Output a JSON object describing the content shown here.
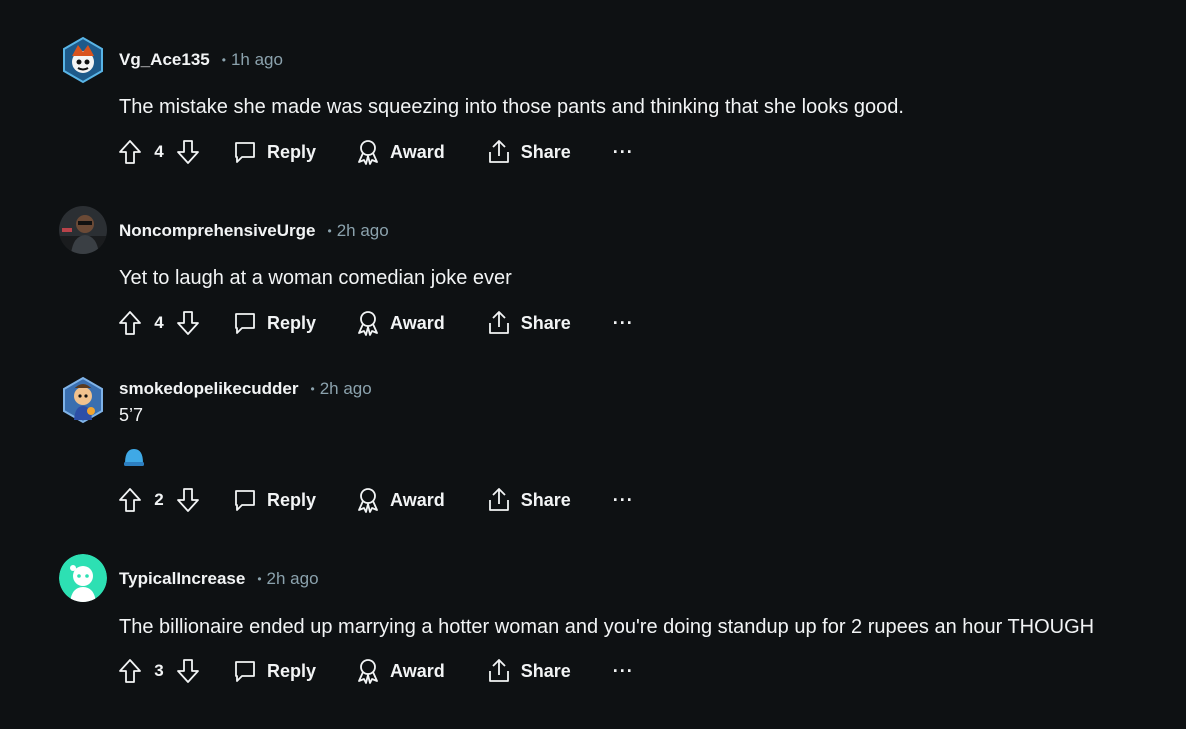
{
  "comments": [
    {
      "username": "Vg_Ace135",
      "time": "1h ago",
      "text": "The mistake she made was squeezing into those pants and thinking that she looks good.",
      "score": "4"
    },
    {
      "username": "NoncomprehensiveUrge",
      "time": "2h ago",
      "text": "Yet to laugh at a woman comedian joke ever",
      "score": "4"
    },
    {
      "username": "smokedopelikecudder",
      "time": "2h ago",
      "text": "5’7",
      "score": "2"
    },
    {
      "username": "TypicalIncrease",
      "time": "2h ago",
      "text": "The billionaire ended up marrying a hotter woman and you're doing standup up for 2 rupees an hour THOUGH",
      "score": "3"
    }
  ],
  "actions": {
    "reply": "Reply",
    "award": "Award",
    "share": "Share",
    "more": "···"
  },
  "colors": {
    "background": "#0e1113",
    "text": "#f2f4f5",
    "meta": "#8ba2ad",
    "avatar_teal": "#2de0b3"
  },
  "icons": {
    "upvote": "upvote-arrow-icon",
    "downvote": "downvote-arrow-icon",
    "reply": "speech-bubble-icon",
    "award": "award-ribbon-icon",
    "share": "share-upload-icon",
    "emoji": "blue-cap-emoji"
  }
}
